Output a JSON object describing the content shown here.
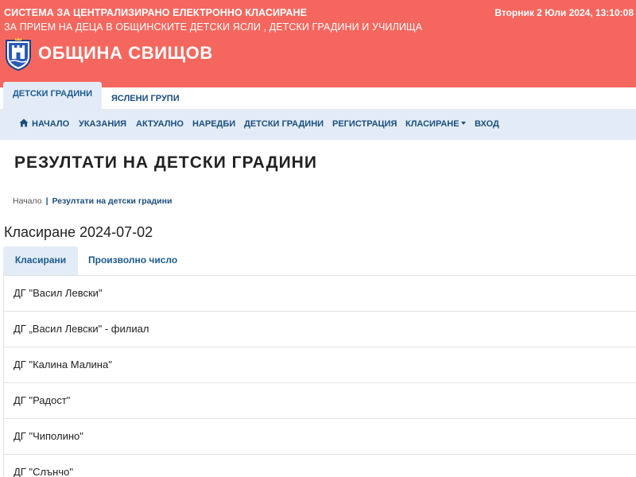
{
  "header": {
    "title": "СИСТЕМА ЗА ЦЕНТРАЛИЗИРАНО ЕЛЕКТРОННО КЛАСИРАНЕ",
    "subtitle": "ЗА ПРИЕМ НА ДЕЦА В ОБЩИНСКИТЕ ДЕТСКИ ЯСЛИ , ДЕТСКИ ГРАДИНИ И УЧИЛИЩА",
    "datetime": "Вторник 2 Юли 2024, 13:10:08",
    "municipality": "ОБЩИНА СВИЩОВ",
    "logo_icon": "municipality-coat-of-arms",
    "background_color": "#f5675e"
  },
  "top_tabs": [
    {
      "label": "ДЕТСКИ ГРАДИНИ",
      "active": true
    },
    {
      "label": "ЯСЛЕНИ ГРУПИ",
      "active": false
    }
  ],
  "nav": {
    "home_icon": "home-icon",
    "items": [
      {
        "label": "НАЧАЛО"
      },
      {
        "label": "УКАЗАНИЯ"
      },
      {
        "label": "АКТУАЛНО"
      },
      {
        "label": "НАРЕДБИ"
      },
      {
        "label": "ДЕТСКИ ГРАДИНИ"
      },
      {
        "label": "РЕГИСТРАЦИЯ"
      },
      {
        "label": "КЛАСИРАНЕ",
        "dropdown": true
      },
      {
        "label": "ВХОД"
      }
    ]
  },
  "page": {
    "title": "РЕЗУЛТАТИ НА ДЕТСКИ ГРАДИНИ",
    "breadcrumb": {
      "home": "Начало",
      "separator": "|",
      "current": "Резултати на детски градини"
    },
    "subheading": "Класиране 2024-07-02"
  },
  "result_tabs": [
    {
      "label": "Класирани",
      "active": true
    },
    {
      "label": "Произволно число",
      "active": false
    }
  ],
  "kindergartens": [
    "ДГ \"Васил Левски\"",
    "ДГ „Васил Левски\" - филиал",
    "ДГ \"Калина Малина\"",
    "ДГ \"Радост\"",
    "ДГ \"Чиполино\"",
    "ДГ \"Слънчо\""
  ],
  "colors": {
    "accent": "#f5675e",
    "nav_background": "#e3ecf6",
    "link": "#1a4e7e"
  }
}
